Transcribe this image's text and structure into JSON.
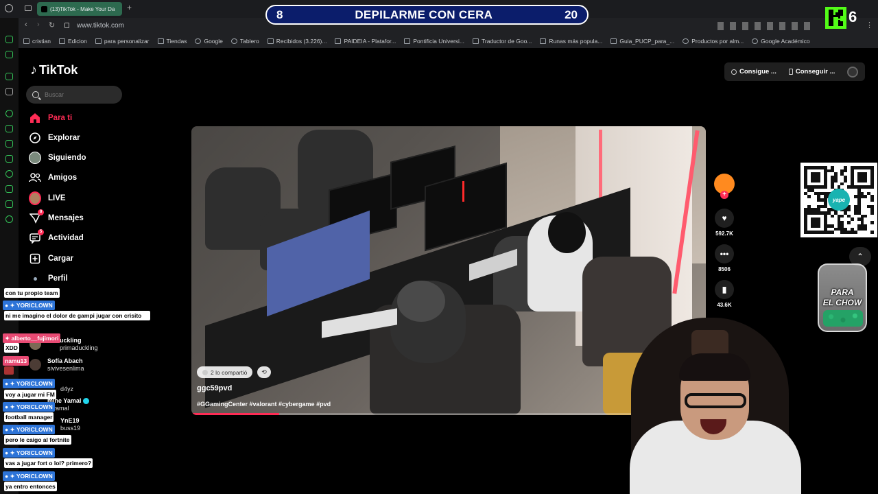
{
  "browser": {
    "tab_title": "(13)TikTok - Make Your Da",
    "url": "www.tiktok.com",
    "bookmarks": [
      "cristian",
      "Edicion",
      "para personalizar",
      "Tiendas",
      "Google",
      "Tablero",
      "Recibidos (3.226)...",
      "PAIDEIA - Platafor...",
      "Pontificia Universi...",
      "Traductor de Goo...",
      "Runas más popula...",
      "Guia_PUCP_para_...",
      "Productos por alm...",
      "Google Académico"
    ]
  },
  "overlay": {
    "banner_left": "8",
    "banner_title": "DEPILARME CON CERA",
    "banner_right": "20",
    "k_count": "6",
    "jar_text_line1": "PARA",
    "jar_text_line2": "EL CHOW",
    "qr_label": "yape"
  },
  "tiktok": {
    "logo": "TikTok",
    "search_placeholder": "Buscar",
    "nav": [
      {
        "label": "Para ti"
      },
      {
        "label": "Explorar"
      },
      {
        "label": "Siguiendo"
      },
      {
        "label": "Amigos"
      },
      {
        "label": "LIVE"
      },
      {
        "label": "Mensajes",
        "badge": "8"
      },
      {
        "label": "Actividad",
        "badge": "5"
      },
      {
        "label": "Cargar"
      },
      {
        "label": "Perfil"
      }
    ],
    "get_app_1": "Consigue ...",
    "get_app_2": "Conseguir ...",
    "video": {
      "shared": "2 lo compartió",
      "author": "ggc59pvd",
      "tags": "#GGamingCenter #valorant #cybergame #pvd",
      "progress_fraction": 0.17
    },
    "actions": {
      "likes": "592.7K",
      "comments": "8506",
      "saves": "43.6K"
    },
    "following": [
      {
        "name": "uckling",
        "handle": "primaduckling"
      },
      {
        "name": "Sofía Abach",
        "handle": "sivivesenlima"
      },
      {
        "name": "",
        "handle": "d4yz"
      },
      {
        "name": "mine Yamal",
        "handle": "e.yamal"
      },
      {
        "name": "YnE19",
        "handle": "buss19"
      }
    ]
  },
  "chat": [
    {
      "user": "",
      "msg": "con tu propio team"
    },
    {
      "user": "YORICLOWN",
      "msg": "ni me imagino el dolor de gampi jugar con crisito"
    },
    {
      "user": "alberto__fujimori",
      "msg": "XDD"
    },
    {
      "user": "namu13",
      "msg": ""
    },
    {
      "user": "YORICLOWN",
      "msg": "voy a jugar mi FM"
    },
    {
      "user": "YORICLOWN",
      "msg": "football manager"
    },
    {
      "user": "YORICLOWN",
      "msg": "pero le caigo al fortnite"
    },
    {
      "user": "YORICLOWN",
      "msg": "vas a jugar fort o lol? primero?"
    },
    {
      "user": "YORICLOWN",
      "msg": "ya entro entonces"
    }
  ]
}
